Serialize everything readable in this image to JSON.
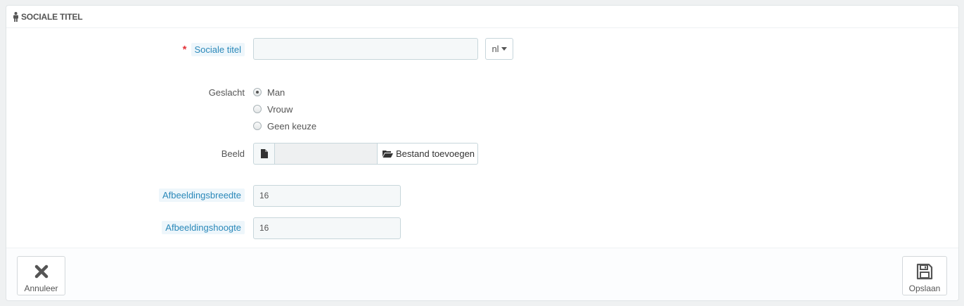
{
  "panel": {
    "title": "SOCIALE TITEL",
    "icon": "user-icon"
  },
  "form": {
    "social_title": {
      "required_mark": "*",
      "label": "Sociale titel",
      "value": "",
      "language": "nl"
    },
    "gender": {
      "label": "Geslacht",
      "options": [
        {
          "label": "Man",
          "checked": true
        },
        {
          "label": "Vrouw",
          "checked": false
        },
        {
          "label": "Geen keuze",
          "checked": false
        }
      ]
    },
    "image": {
      "label": "Beeld",
      "file_name": "",
      "add_button_label": "Bestand toevoegen"
    },
    "image_width": {
      "label": "Afbeeldingsbreedte",
      "value": "16"
    },
    "image_height": {
      "label": "Afbeeldingshoogte",
      "value": "16"
    }
  },
  "footer": {
    "cancel_label": "Annuleer",
    "save_label": "Opslaan"
  },
  "colors": {
    "hint_label_text": "#2a88b9",
    "hint_label_bg": "#eef6fb",
    "required": "#e3343a"
  }
}
